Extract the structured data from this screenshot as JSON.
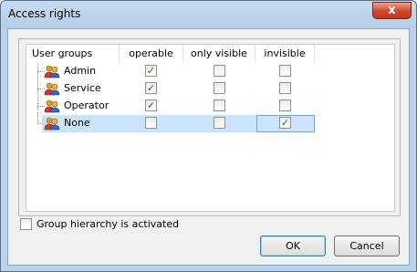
{
  "window": {
    "title": "Access rights",
    "close_glyph": "x"
  },
  "table": {
    "columns": [
      "User groups",
      "operable",
      "only visible",
      "invisible"
    ],
    "rows": [
      {
        "label": "Admin",
        "operable": true,
        "only_visible": false,
        "invisible": false
      },
      {
        "label": "Service",
        "operable": true,
        "only_visible": false,
        "invisible": false
      },
      {
        "label": "Operator",
        "operable": true,
        "only_visible": false,
        "invisible": false
      },
      {
        "label": "None",
        "operable": false,
        "only_visible": false,
        "invisible": true,
        "selected": true
      }
    ]
  },
  "options": {
    "group_hierarchy_label": "Group hierarchy is activated",
    "group_hierarchy_checked": false
  },
  "buttons": {
    "ok": "OK",
    "cancel": "Cancel"
  },
  "icons": {
    "row_icon": "user-group-icon",
    "check": "✓"
  }
}
